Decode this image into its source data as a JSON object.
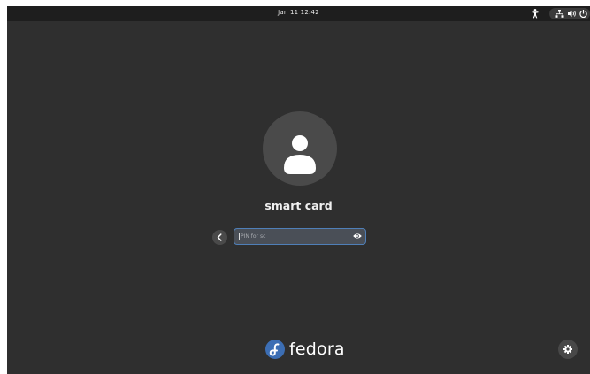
{
  "topbar": {
    "clock": "Jan 11  12:42",
    "icons": [
      "accessibility-icon",
      "network-icon",
      "volume-icon",
      "power-icon"
    ]
  },
  "login": {
    "avatar_icon": "user-icon",
    "username": "smart card",
    "pin_placeholder": "PIN for sc",
    "pin_value": "",
    "back_icon": "chevron-left-icon",
    "reveal_icon": "eye-icon"
  },
  "branding": {
    "logo_text": "fedora",
    "logo_icon": "fedora-icon"
  },
  "footer": {
    "settings_icon": "gear-icon"
  },
  "colors": {
    "background": "#2f2f2f",
    "topbar": "#1e1e1e",
    "field_border": "#4f7fb8",
    "fedora_blue": "#3c6eb4"
  }
}
